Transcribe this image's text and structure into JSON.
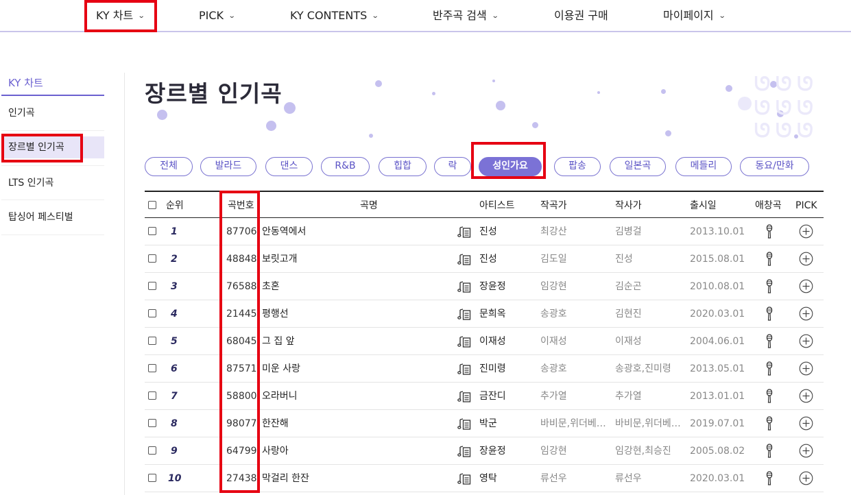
{
  "nav": {
    "items": [
      {
        "label": "KY 차트",
        "icon": "chevron-down-icon"
      },
      {
        "label": "PICK",
        "icon": "chevron-down-icon"
      },
      {
        "label": "KY CONTENTS",
        "icon": "chevron-down-icon"
      },
      {
        "label": "반주곡 검색",
        "icon": "chevron-down-icon"
      },
      {
        "label": "이용권 구매"
      },
      {
        "label": "마이페이지",
        "icon": "chevron-down-icon"
      }
    ]
  },
  "sidebar": {
    "title": "KY 차트",
    "items": [
      {
        "label": "인기곡"
      },
      {
        "label": "장르별 인기곡"
      },
      {
        "label": "LTS 인기곡"
      },
      {
        "label": "탑싱어 페스티벌"
      }
    ]
  },
  "page": {
    "title": "장르별 인기곡",
    "decor_text": "ᘎᘎᘎ"
  },
  "genre_tabs": [
    "전체",
    "발라드",
    "댄스",
    "R&B",
    "힙합",
    "락",
    "성인가요",
    "팝송",
    "일본곡",
    "메들리",
    "동요/만화"
  ],
  "active_tab": "성인가요",
  "table": {
    "headers": {
      "rank": "순위",
      "number": "곡번호",
      "title": "곡명",
      "artist": "아티스트",
      "composer": "작곡가",
      "lyricist": "작사가",
      "release": "출시일",
      "karaoke": "애창곡",
      "pick": "PICK"
    },
    "rows": [
      {
        "rank": "1",
        "number": "87706",
        "title": "안동역에서",
        "artist": "진성",
        "composer": "최강산",
        "lyricist": "김병걸",
        "release": "2013.10.01"
      },
      {
        "rank": "2",
        "number": "48848",
        "title": "보릿고개",
        "artist": "진성",
        "composer": "김도일",
        "lyricist": "진성",
        "release": "2015.08.01"
      },
      {
        "rank": "3",
        "number": "76588",
        "title": "초혼",
        "artist": "장윤정",
        "composer": "임강현",
        "lyricist": "김순곤",
        "release": "2010.08.01"
      },
      {
        "rank": "4",
        "number": "21445",
        "title": "평행선",
        "artist": "문희옥",
        "composer": "송광호",
        "lyricist": "김현진",
        "release": "2020.03.01"
      },
      {
        "rank": "5",
        "number": "68045",
        "title": "그 집 앞",
        "artist": "이재성",
        "composer": "이재성",
        "lyricist": "이재성",
        "release": "2004.06.01"
      },
      {
        "rank": "6",
        "number": "87571",
        "title": "미운 사랑",
        "artist": "진미령",
        "composer": "송광호",
        "lyricist": "송광호,진미령",
        "release": "2013.05.01"
      },
      {
        "rank": "7",
        "number": "58800",
        "title": "오라버니",
        "artist": "금잔디",
        "composer": "추가열",
        "lyricist": "추가열",
        "release": "2013.01.01"
      },
      {
        "rank": "8",
        "number": "98077",
        "title": "한잔해",
        "artist": "박군",
        "composer": "바비문,위더베…",
        "lyricist": "바비문,위더베…",
        "release": "2019.07.01"
      },
      {
        "rank": "9",
        "number": "64799",
        "title": "사랑아",
        "artist": "장윤정",
        "composer": "임강현",
        "lyricist": "임강현,최승진",
        "release": "2005.08.02"
      },
      {
        "rank": "10",
        "number": "27438",
        "title": "막걸리 한잔",
        "artist": "영탁",
        "composer": "류선우",
        "lyricist": "류선우",
        "release": "2020.03.01"
      }
    ]
  },
  "colors": {
    "accent": "#7b72d6",
    "highlight": "#e60012",
    "nav_border": "#c9c4ea"
  }
}
